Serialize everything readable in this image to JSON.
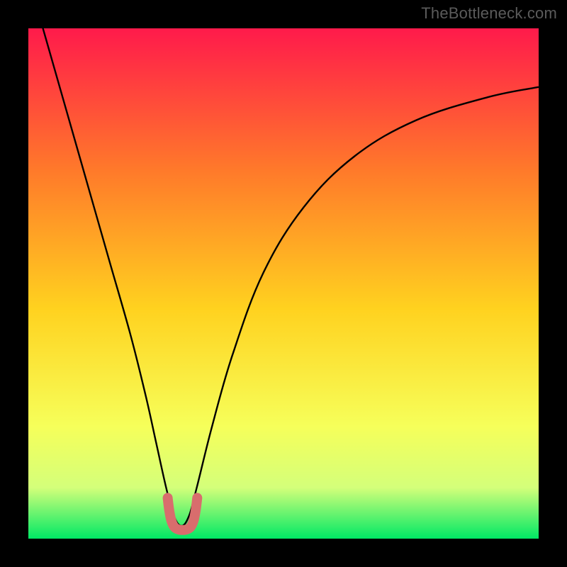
{
  "watermark": "TheBottleneck.com",
  "colors": {
    "page_bg": "#000000",
    "watermark_text": "#5b5b5b",
    "curve": "#000000",
    "bottom_marker": "#d86d6d",
    "gradient_top": "#ff1a4b",
    "gradient_mid_upper": "#ff7a2a",
    "gradient_mid": "#ffd21f",
    "gradient_mid_lower": "#f6ff5a",
    "gradient_band": "#d4ff7a",
    "gradient_bottom": "#00e865"
  },
  "chart_data": {
    "type": "line",
    "title": "",
    "xlabel": "",
    "ylabel": "",
    "xlim": [
      0,
      100
    ],
    "ylim": [
      0,
      100
    ],
    "series": [
      {
        "name": "bottleneck-curve",
        "x": [
          0,
          4,
          8,
          12,
          16,
          20,
          23,
          25,
          27,
          28.5,
          30,
          31.5,
          33,
          36,
          40,
          46,
          54,
          64,
          76,
          90,
          100
        ],
        "y": [
          110,
          96,
          82,
          68,
          54,
          40,
          28,
          19,
          10,
          4.5,
          2.5,
          4.5,
          10,
          22,
          36,
          52,
          65,
          75,
          82,
          86.5,
          88.5
        ]
      },
      {
        "name": "bottom-marker-u",
        "x": [
          27.3,
          27.6,
          28.0,
          28.6,
          29.4,
          30.2,
          31.0,
          31.8,
          32.4,
          32.8,
          33.1
        ],
        "y": [
          8.0,
          5.6,
          3.6,
          2.3,
          1.8,
          1.7,
          1.8,
          2.3,
          3.6,
          5.6,
          8.0
        ]
      }
    ],
    "gradient_stops": [
      {
        "offset": 0.0,
        "color": "#ff1a4b"
      },
      {
        "offset": 0.28,
        "color": "#ff7a2a"
      },
      {
        "offset": 0.55,
        "color": "#ffd21f"
      },
      {
        "offset": 0.78,
        "color": "#f6ff5a"
      },
      {
        "offset": 0.9,
        "color": "#d4ff7a"
      },
      {
        "offset": 1.0,
        "color": "#00e865"
      }
    ]
  }
}
